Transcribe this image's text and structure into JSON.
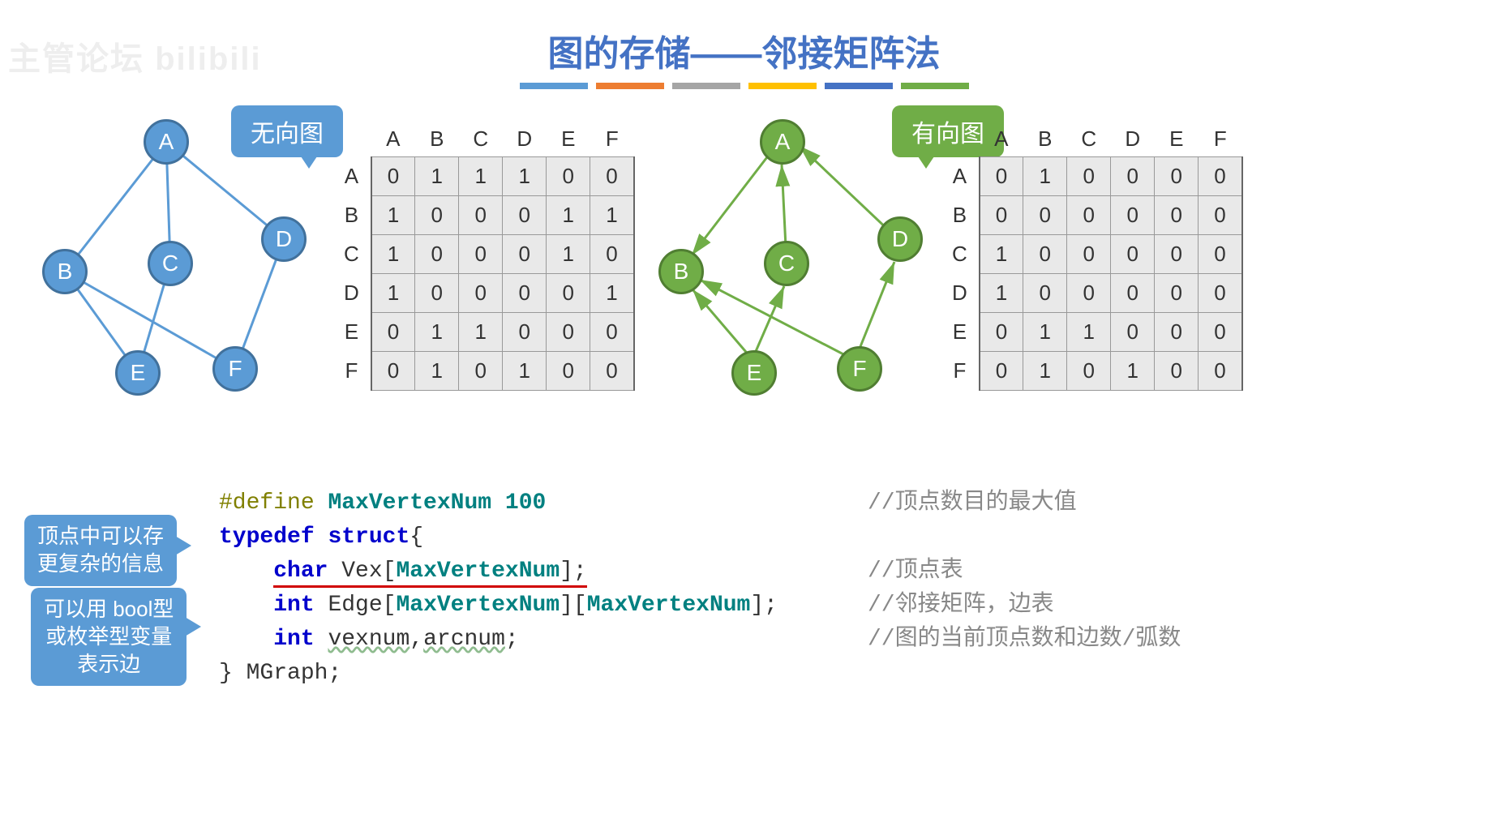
{
  "title": "图的存储——邻接矩阵法",
  "watermark": "主管论坛 bilibili",
  "bars": [
    "#5b9bd5",
    "#ed7d31",
    "#a5a5a5",
    "#ffc000",
    "#4472c4",
    "#70ad47"
  ],
  "labels": {
    "undirected": "无向图",
    "directed": "有向图"
  },
  "headers": [
    "A",
    "B",
    "C",
    "D",
    "E",
    "F"
  ],
  "matrix_undirected": [
    [
      0,
      1,
      1,
      1,
      0,
      0
    ],
    [
      1,
      0,
      0,
      0,
      1,
      1
    ],
    [
      1,
      0,
      0,
      0,
      1,
      0
    ],
    [
      1,
      0,
      0,
      0,
      0,
      1
    ],
    [
      0,
      1,
      1,
      0,
      0,
      0
    ],
    [
      0,
      1,
      0,
      1,
      0,
      0
    ]
  ],
  "matrix_directed": [
    [
      0,
      1,
      0,
      0,
      0,
      0
    ],
    [
      0,
      0,
      0,
      0,
      0,
      0
    ],
    [
      1,
      0,
      0,
      0,
      0,
      0
    ],
    [
      1,
      0,
      0,
      0,
      0,
      0
    ],
    [
      0,
      1,
      1,
      0,
      0,
      0
    ],
    [
      0,
      1,
      0,
      1,
      0,
      0
    ]
  ],
  "nodes": [
    "A",
    "B",
    "C",
    "D",
    "E",
    "F"
  ],
  "code": {
    "l1a": "#define",
    "l1b": "MaxVertexNum",
    "l1c": "100",
    "l2a": "typedef",
    "l2b": "struct",
    "l2c": "{",
    "l3a": "char",
    "l3b": "Vex",
    "l3c": "[",
    "l3d": "MaxVertexNum",
    "l3e": "];",
    "l4a": "int",
    "l4b": "Edge[",
    "l4c": "MaxVertexNum",
    "l4d": "][",
    "l4e": "MaxVertexNum",
    "l4f": "];",
    "l5a": "int",
    "l5b": "vexnum",
    "l5c": ",",
    "l5d": "arcnum",
    "l5e": ";",
    "l6a": "}",
    "l6b": "MGraph;"
  },
  "comments": {
    "c1": "//顶点数目的最大值",
    "c2": "//顶点表",
    "c3": "//邻接矩阵，边表",
    "c4": "//图的当前顶点数和边数/弧数"
  },
  "annot": {
    "a1": "顶点中可以存\n更复杂的信息",
    "a2": "可以用 bool型\n或枚举型变量\n表示边"
  }
}
